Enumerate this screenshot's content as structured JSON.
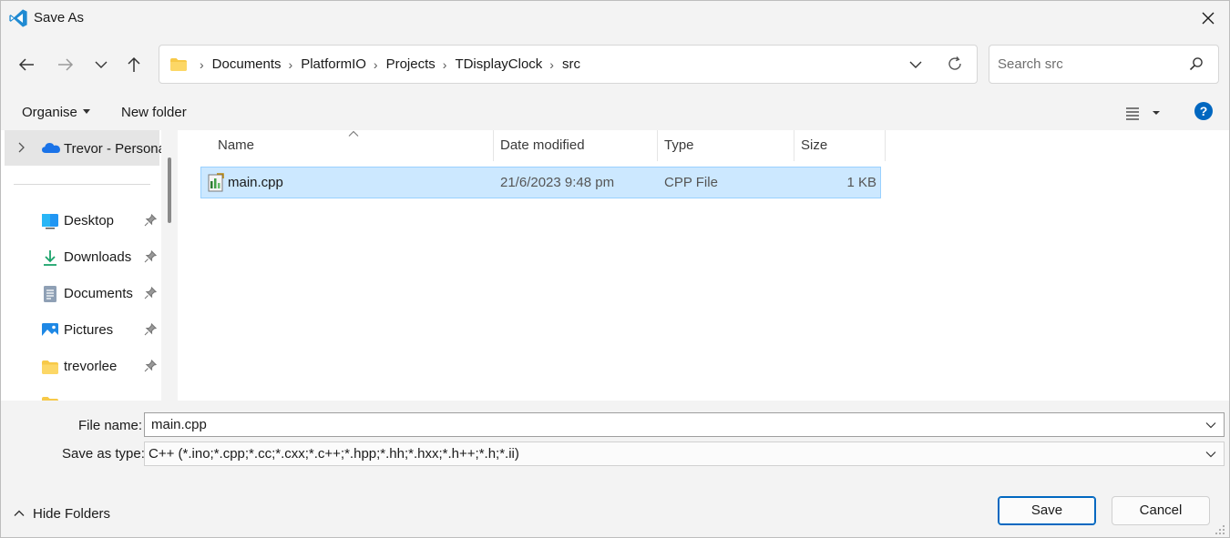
{
  "window": {
    "title": "Save As",
    "app_icon": "vscode-icon",
    "close_icon": "close-icon"
  },
  "nav": {
    "back_icon": "back-arrow-icon",
    "forward_icon": "forward-arrow-icon",
    "recent_icon": "chevron-down-icon",
    "up_icon": "up-arrow-icon"
  },
  "address": {
    "folder_icon": "folder-icon",
    "crumbs": [
      "Documents",
      "PlatformIO",
      "Projects",
      "TDisplayClock",
      "src"
    ],
    "dropdown_icon": "chevron-down-icon",
    "refresh_icon": "refresh-icon"
  },
  "search": {
    "placeholder": "Search src",
    "icon": "search-icon"
  },
  "commands": {
    "organise": "Organise",
    "new_folder": "New folder",
    "view_icon": "list-view-icon",
    "help_icon": "help-icon"
  },
  "sidebar": {
    "root": {
      "label": "Trevor - Persona",
      "icon": "onedrive-cloud-icon"
    },
    "items": [
      {
        "label": "Desktop",
        "icon": "desktop-icon",
        "pinned": true
      },
      {
        "label": "Downloads",
        "icon": "downloads-icon",
        "pinned": true
      },
      {
        "label": "Documents",
        "icon": "documents-icon",
        "pinned": true
      },
      {
        "label": "Pictures",
        "icon": "pictures-icon",
        "pinned": true
      },
      {
        "label": "trevorlee",
        "icon": "folder-icon",
        "pinned": true
      }
    ]
  },
  "files": {
    "columns": [
      "Name",
      "Date modified",
      "Type",
      "Size"
    ],
    "rows": [
      {
        "name": "main.cpp",
        "date": "21/6/2023 9:48 pm",
        "type": "CPP File",
        "size": "1 KB",
        "icon": "cpp-file-icon",
        "selected": true
      }
    ]
  },
  "form": {
    "file_name_label": "File name:",
    "file_name_value": "main.cpp",
    "save_type_label": "Save as type:",
    "save_type_value": "C++ (*.ino;*.cpp;*.cc;*.cxx;*.c++;*.hpp;*.hh;*.hxx;*.h++;*.h;*.ii)"
  },
  "footer": {
    "hide_folders": "Hide Folders",
    "save": "Save",
    "cancel": "Cancel"
  },
  "colors": {
    "accent": "#0067c0",
    "selection": "#cce8ff",
    "chrome": "#f3f3f3"
  }
}
